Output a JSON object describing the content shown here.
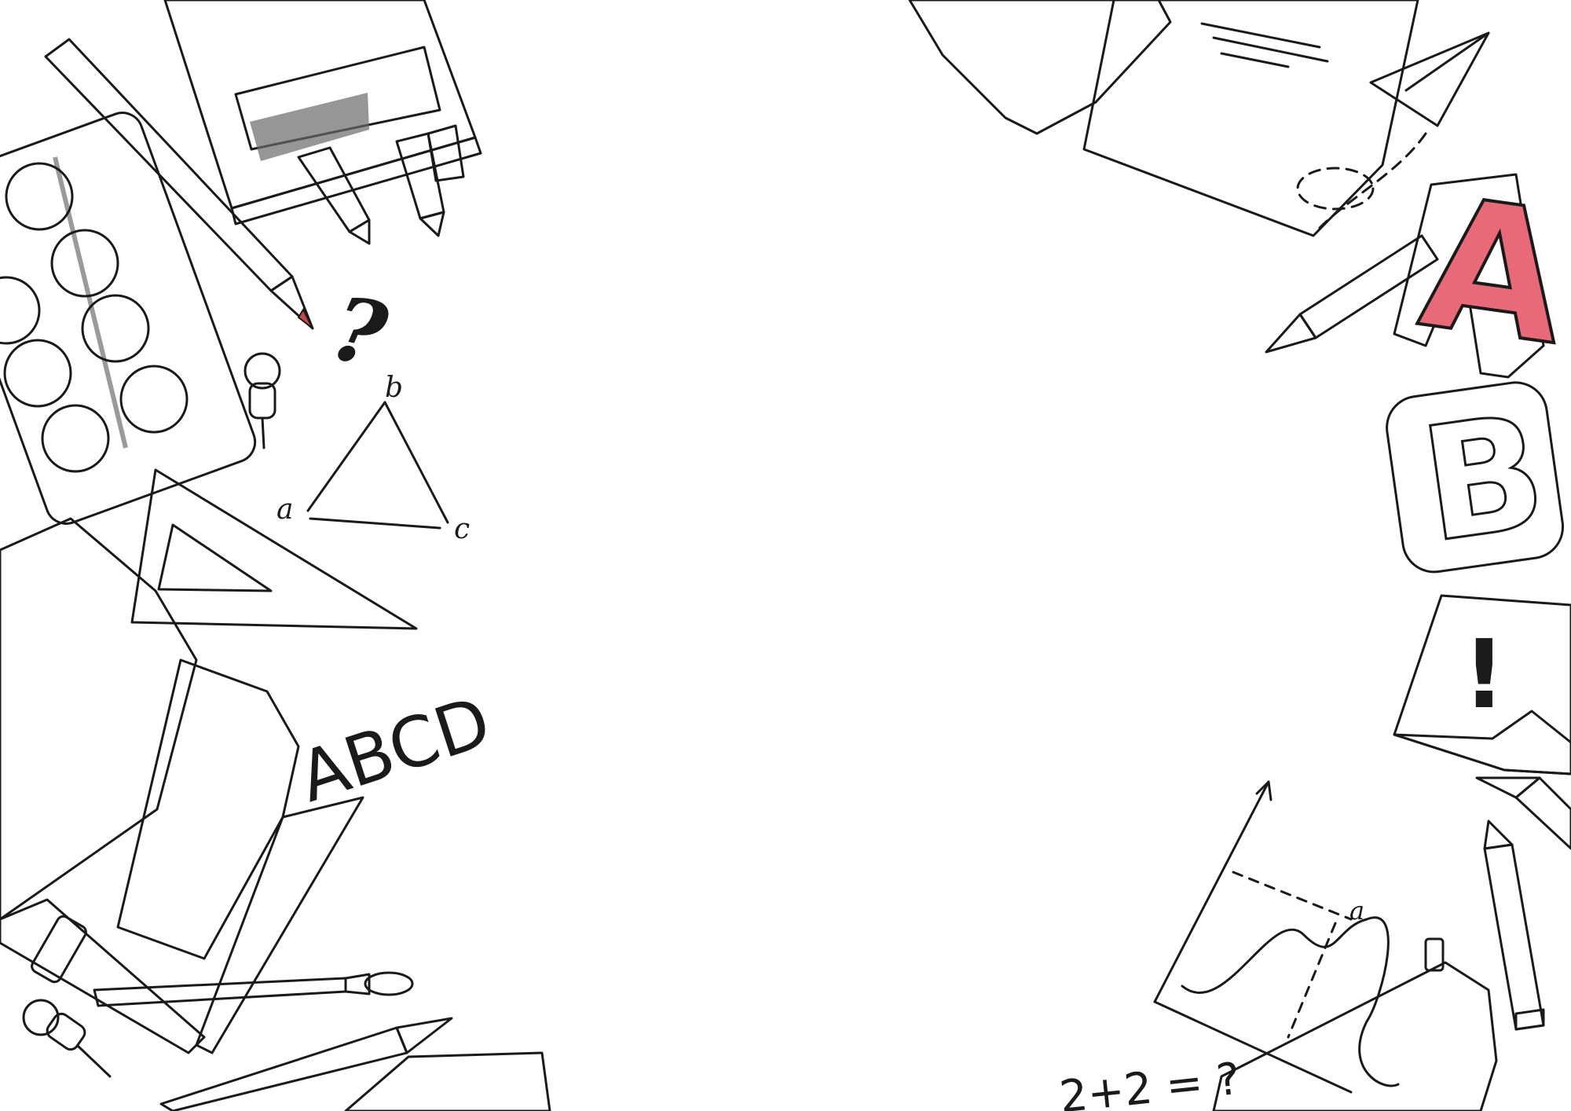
{
  "left_cluster": {
    "triangle_vertices": {
      "top": "b",
      "left": "a",
      "right": "c"
    },
    "book_letters": "ABCD",
    "question_mark": "?"
  },
  "right_cluster": {
    "block_letter_1": "A",
    "block_letter_2": "B",
    "sticky_note_mark": "!",
    "graph_point": "a",
    "equation": "2+2 = ?"
  },
  "colors": {
    "paint_green": "#8fd19e",
    "paint_red": "#ec6f7c",
    "paint_tan": "#d8c3ae",
    "paint_cyan": "#8fd7e3",
    "paint_blue": "#8fa8e6",
    "paint_black": "#4a4a4a",
    "paint_salmon": "#e8867a",
    "pencil_red": "#e28a7d",
    "crayon_box": "#f4d98b",
    "ruler": "#f3c98a",
    "notebook_green": "#b9e6b2",
    "letter_a": "#e86a78",
    "letter_b": "#9adff0",
    "sticky_pink": "#f7c3cf",
    "pouch": "#d8c0ad",
    "book_spine": "#e97486",
    "pencil_yellow": "#f6cf6b"
  }
}
